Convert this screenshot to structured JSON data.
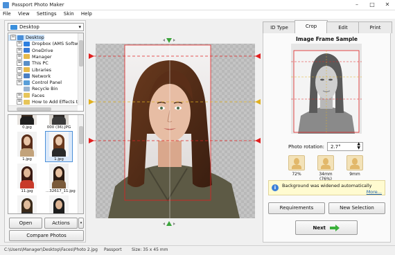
{
  "window": {
    "title": "Passport Photo Maker",
    "minimize": "–",
    "maximize": "□",
    "close": "✕"
  },
  "menu": [
    "File",
    "View",
    "Settings",
    "Skin",
    "Help"
  ],
  "folder_select": {
    "value": "Desktop",
    "arrow": "▾"
  },
  "tree": [
    {
      "label": "Desktop",
      "indent": 0,
      "expander": "⊟",
      "color": "#4a8fd8",
      "selected": true
    },
    {
      "label": "Dropbox (AMS Softwa",
      "indent": 1,
      "expander": "⊞",
      "color": "#2d7fe0"
    },
    {
      "label": "OneDrive",
      "indent": 1,
      "expander": "⊞",
      "color": "#3a7bd5"
    },
    {
      "label": "Manager",
      "indent": 1,
      "expander": "⊞",
      "color": "#e6b94a"
    },
    {
      "label": "This PC",
      "indent": 1,
      "expander": "⊞",
      "color": "#5a8fc7"
    },
    {
      "label": "Libraries",
      "indent": 1,
      "expander": "⊞",
      "color": "#e6b94a"
    },
    {
      "label": "Network",
      "indent": 1,
      "expander": "⊞",
      "color": "#4a7fc4"
    },
    {
      "label": "Control Panel",
      "indent": 1,
      "expander": "⊞",
      "color": "#5a9fd8"
    },
    {
      "label": "Recycle Bin",
      "indent": 1,
      "expander": "",
      "color": "#9ab4cf"
    },
    {
      "label": "Faces",
      "indent": 1,
      "expander": "⊞",
      "color": "#e6c55a"
    },
    {
      "label": "How to Add Effects to",
      "indent": 1,
      "expander": "⊞",
      "color": "#e6c55a"
    }
  ],
  "thumbnails": [
    {
      "label": "0.jpg",
      "bg": "#e8e4e0",
      "hair": "#3a2a1e",
      "skin": "#e6c4a8",
      "cloth": "#1e1e1e"
    },
    {
      "label": "000 (36).JPG",
      "bg": "#d8d4ce",
      "hair": "#2a2522",
      "skin": "#dab79c",
      "cloth": "#3a3a3a"
    },
    {
      "label": "1.jpg",
      "bg": "#f2f2f2",
      "hair": "#5a2e1a",
      "skin": "#e8c4a6",
      "cloth": "#c2a27a"
    },
    {
      "label": "1.jpg",
      "bg": "#f6f6f6",
      "hair": "#6a3a1e",
      "skin": "#e8c8ac",
      "cloth": "#2a2a2a",
      "selected": true
    },
    {
      "label": "11.jpg",
      "bg": "#f4f4f4",
      "hair": "#3a1a12",
      "skin": "#e0b898",
      "cloth": "#c83a2a"
    },
    {
      "label": "...32617_11.jpg",
      "bg": "#f0f0f0",
      "hair": "#2a1a12",
      "skin": "#e6c0a0",
      "cloth": "#7a5a3a"
    },
    {
      "label": "",
      "bg": "#f4f4f4",
      "hair": "#3a2a1a",
      "skin": "#e0bc9c",
      "cloth": "#2a2a2a"
    },
    {
      "label": "",
      "bg": "#f4f4f4",
      "hair": "#1e1e1e",
      "skin": "#dcb494",
      "cloth": "#1e1e1e"
    }
  ],
  "left_buttons": {
    "open": "Open",
    "actions": "Actions",
    "actions_arrow": "▾",
    "compare": "Compare Photos"
  },
  "tabs": [
    {
      "label": "ID Type"
    },
    {
      "label": "Crop",
      "active": true
    },
    {
      "label": "Edit"
    },
    {
      "label": "Print"
    }
  ],
  "sample": {
    "title": "Image Frame Sample"
  },
  "rotation": {
    "label": "Photo rotation:",
    "value": "2.7°"
  },
  "measures": [
    {
      "value": "72%",
      "icon": "head-height-icon"
    },
    {
      "value": "34mm (76%)",
      "icon": "face-width-icon"
    },
    {
      "value": "9mm",
      "icon": "top-margin-icon"
    }
  ],
  "info": {
    "message": "Background was widened automatically",
    "more": "More..."
  },
  "right_buttons": {
    "requirements": "Requirements",
    "new_selection": "New Selection",
    "next": "Next"
  },
  "status": {
    "path": "C:\\Users\\Manager\\Desktop\\Faces\\Photo 2.jpg",
    "type": "Passport",
    "size": "Size: 35 x 45 mm"
  },
  "colors": {
    "accent": "#4a8fd8",
    "guide_red": "#e02020",
    "guide_yellow": "#e0b020",
    "handle_green": "#3aa43a",
    "next_arrow": "#3ab03a"
  }
}
